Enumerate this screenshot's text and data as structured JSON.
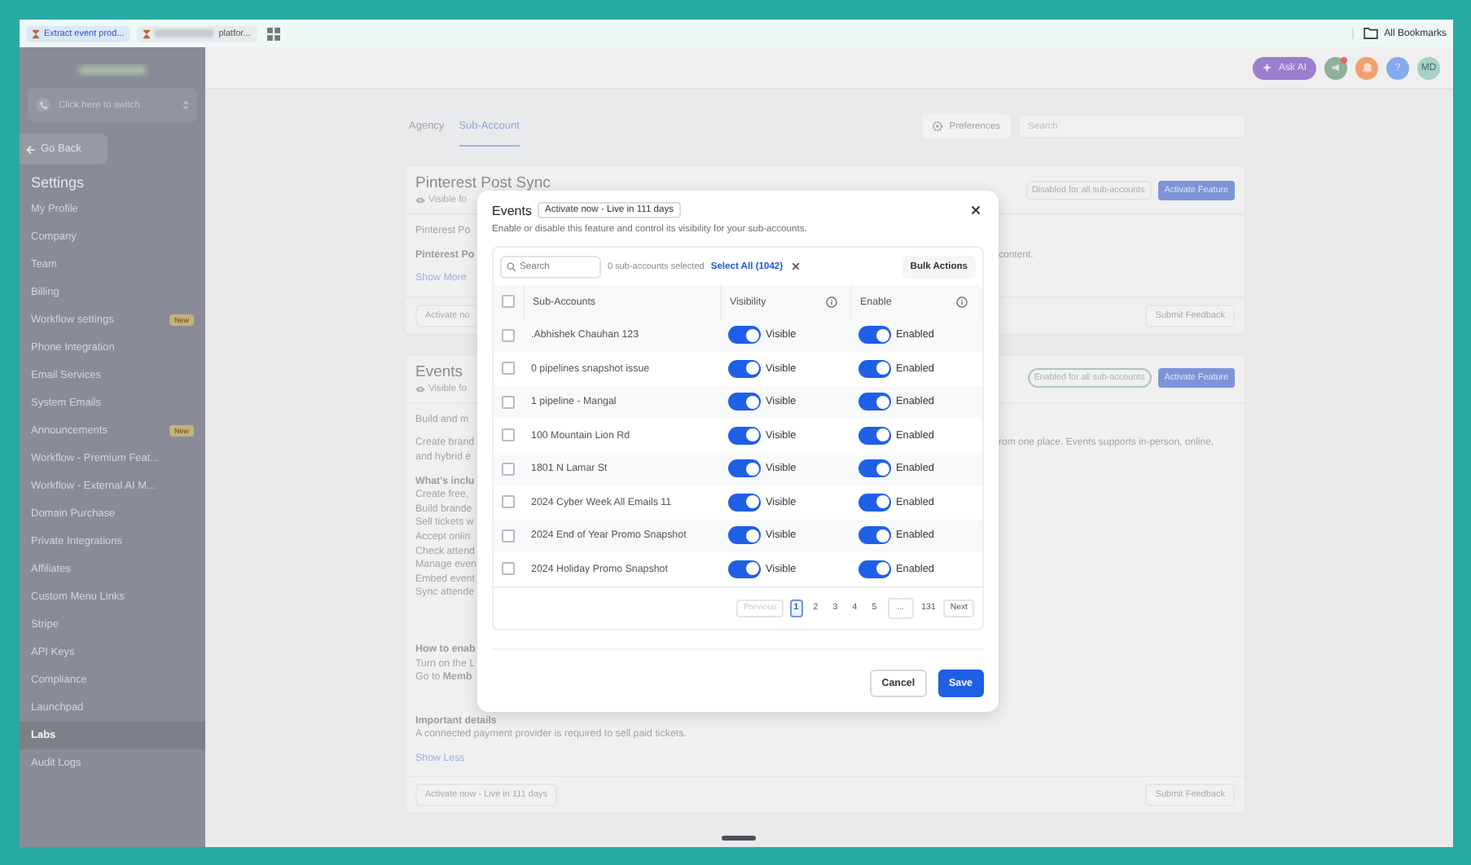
{
  "browser_bar": {
    "tabs": [
      {
        "label": "Extract event prod...",
        "selected": true
      },
      {
        "label": "platfor...",
        "selected": false
      }
    ],
    "bookmarks_folder": "All Bookmarks"
  },
  "top_bar": {
    "ask_ai": "Ask AI",
    "help": "?",
    "avatar": "MD"
  },
  "sidebar": {
    "switcher": "Click here to switch",
    "back": "Go Back",
    "heading": "Settings",
    "items": [
      {
        "label": "My Profile",
        "selected": false
      },
      {
        "label": "Company",
        "selected": false
      },
      {
        "label": "Team",
        "selected": false
      },
      {
        "label": "Billing",
        "selected": false
      },
      {
        "label": "Workflow settings",
        "selected": false,
        "badge": "New"
      },
      {
        "label": "Phone Integration",
        "selected": false
      },
      {
        "label": "Email Services",
        "selected": false
      },
      {
        "label": "System Emails",
        "selected": false
      },
      {
        "label": "Announcements",
        "selected": false,
        "badge": "New"
      },
      {
        "label": "Workflow - Premium Feat...",
        "selected": false
      },
      {
        "label": "Workflow - External AI M...",
        "selected": false
      },
      {
        "label": "Domain Purchase",
        "selected": false
      },
      {
        "label": "Private Integrations",
        "selected": false
      },
      {
        "label": "Affiliates",
        "selected": false
      },
      {
        "label": "Custom Menu Links",
        "selected": false
      },
      {
        "label": "Stripe",
        "selected": false
      },
      {
        "label": "API Keys",
        "selected": false
      },
      {
        "label": "Compliance",
        "selected": false
      },
      {
        "label": "Launchpad",
        "selected": false
      },
      {
        "label": "Labs",
        "selected": true
      },
      {
        "label": "Audit Logs",
        "selected": false
      }
    ]
  },
  "page_tabs": [
    {
      "label": "Agency",
      "selected": false
    },
    {
      "label": "Sub-Account",
      "selected": true
    }
  ],
  "preferences": "Preferences",
  "search": {
    "placeholder": "Search"
  },
  "cards": [
    {
      "title": "Pinterest Post Sync",
      "visibility": "Visible fo",
      "status": {
        "label": "Disabled for all sub-accounts",
        "enabled": false
      },
      "action": "Activate Feature",
      "sections": [
        [
          {
            "kind": "text",
            "text": "Pinterest Po"
          }
        ],
        [
          {
            "kind": "heading",
            "text": "Pinterest Po",
            "aside": "content."
          }
        ],
        [
          {
            "kind": "link",
            "text": "Show More"
          }
        ]
      ],
      "footer": {
        "activate": "Activate no",
        "feedback": "Submit Feedback"
      }
    },
    {
      "title": "Events",
      "visibility": "Visible fo",
      "status": {
        "label": "Enabled for all sub-accounts",
        "enabled": true
      },
      "action": "Activate Feature",
      "sections": [
        [
          {
            "kind": "text",
            "text": "Build and m"
          }
        ],
        [
          {
            "kind": "text",
            "text": "Create brand",
            "aside": "rom one place. Events supports in-person, online,"
          },
          {
            "kind": "text",
            "text": "and hybrid e"
          }
        ],
        [
          {
            "kind": "heading",
            "text": "What's inclu"
          },
          {
            "kind": "text",
            "text": "Create free, "
          },
          {
            "kind": "text",
            "text": "Build brande"
          },
          {
            "kind": "text",
            "text": "Sell tickets w"
          },
          {
            "kind": "text",
            "text": "Accept onlin"
          },
          {
            "kind": "text",
            "text": "Check attend"
          },
          {
            "kind": "text",
            "text": "Manage even"
          },
          {
            "kind": "text",
            "text": "Embed event"
          },
          {
            "kind": "text",
            "text": "Sync attende"
          }
        ],
        [
          {
            "kind": "heading",
            "text": "How to enab"
          },
          {
            "kind": "text",
            "text": "Turn on the L"
          },
          {
            "kind": "text",
            "text": "Go to **Memb**"
          }
        ],
        [
          {
            "kind": "heading",
            "text": "Important details"
          },
          {
            "kind": "text",
            "text": "A connected payment provider is required to sell paid tickets."
          }
        ],
        [
          {
            "kind": "link",
            "text": "Show Less"
          }
        ]
      ],
      "footer": {
        "activate": "Activate now - Live in 111 days",
        "feedback": "Submit Feedback"
      }
    }
  ],
  "modal": {
    "title": "Events",
    "badge": "Activate now - Live in 111 days",
    "description": "Enable or disable this feature and control its visibility for your sub-accounts.",
    "search": {
      "placeholder": "Search"
    },
    "selected_count": "0 sub-accounts selected",
    "select_all": "Select All (1042)",
    "bulk_actions": "Bulk Actions",
    "header_checked": false,
    "columns": [
      "Sub-Accounts",
      "Visibility",
      "Enable"
    ],
    "rows": [
      {
        "name": ".Abhishek Chauhan 123",
        "checked": false,
        "visible": true,
        "visible_label": "Visible",
        "enabled": true,
        "enabled_label": "Enabled"
      },
      {
        "name": "0 pipelines snapshot issue",
        "checked": false,
        "visible": true,
        "visible_label": "Visible",
        "enabled": true,
        "enabled_label": "Enabled"
      },
      {
        "name": "1 pipeline - Mangal",
        "checked": false,
        "visible": true,
        "visible_label": "Visible",
        "enabled": true,
        "enabled_label": "Enabled"
      },
      {
        "name": "100 Mountain Lion Rd",
        "checked": false,
        "visible": true,
        "visible_label": "Visible",
        "enabled": true,
        "enabled_label": "Enabled"
      },
      {
        "name": "1801 N Lamar St",
        "checked": false,
        "visible": true,
        "visible_label": "Visible",
        "enabled": true,
        "enabled_label": "Enabled"
      },
      {
        "name": "2024 Cyber Week All Emails 11",
        "checked": false,
        "visible": true,
        "visible_label": "Visible",
        "enabled": true,
        "enabled_label": "Enabled"
      },
      {
        "name": "2024 End of Year Promo Snapshot",
        "checked": false,
        "visible": true,
        "visible_label": "Visible",
        "enabled": true,
        "enabled_label": "Enabled"
      },
      {
        "name": "2024 Holiday Promo Snapshot",
        "checked": false,
        "visible": true,
        "visible_label": "Visible",
        "enabled": true,
        "enabled_label": "Enabled"
      }
    ],
    "pagination": [
      {
        "kind": "nav",
        "label": "Previous",
        "disabled": true
      },
      {
        "kind": "page",
        "label": "1",
        "selected": true
      },
      {
        "kind": "page",
        "label": "2",
        "selected": false
      },
      {
        "kind": "page",
        "label": "3",
        "selected": false
      },
      {
        "kind": "page",
        "label": "4",
        "selected": false
      },
      {
        "kind": "page",
        "label": "5",
        "selected": false
      },
      {
        "kind": "ellipsis",
        "label": "..."
      },
      {
        "kind": "page",
        "label": "131",
        "selected": false
      },
      {
        "kind": "nav",
        "label": "Next",
        "disabled": false
      }
    ],
    "cancel": "Cancel",
    "save": "Save"
  }
}
